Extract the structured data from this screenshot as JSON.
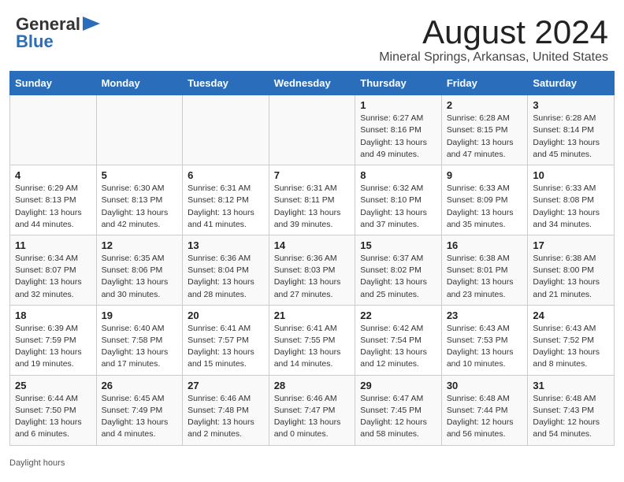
{
  "header": {
    "logo_general": "General",
    "logo_blue": "Blue",
    "month_title": "August 2024",
    "location": "Mineral Springs, Arkansas, United States"
  },
  "days_of_week": [
    "Sunday",
    "Monday",
    "Tuesday",
    "Wednesday",
    "Thursday",
    "Friday",
    "Saturday"
  ],
  "weeks": [
    [
      {
        "day": "",
        "info": ""
      },
      {
        "day": "",
        "info": ""
      },
      {
        "day": "",
        "info": ""
      },
      {
        "day": "",
        "info": ""
      },
      {
        "day": "1",
        "info": "Sunrise: 6:27 AM\nSunset: 8:16 PM\nDaylight: 13 hours\nand 49 minutes."
      },
      {
        "day": "2",
        "info": "Sunrise: 6:28 AM\nSunset: 8:15 PM\nDaylight: 13 hours\nand 47 minutes."
      },
      {
        "day": "3",
        "info": "Sunrise: 6:28 AM\nSunset: 8:14 PM\nDaylight: 13 hours\nand 45 minutes."
      }
    ],
    [
      {
        "day": "4",
        "info": "Sunrise: 6:29 AM\nSunset: 8:13 PM\nDaylight: 13 hours\nand 44 minutes."
      },
      {
        "day": "5",
        "info": "Sunrise: 6:30 AM\nSunset: 8:13 PM\nDaylight: 13 hours\nand 42 minutes."
      },
      {
        "day": "6",
        "info": "Sunrise: 6:31 AM\nSunset: 8:12 PM\nDaylight: 13 hours\nand 41 minutes."
      },
      {
        "day": "7",
        "info": "Sunrise: 6:31 AM\nSunset: 8:11 PM\nDaylight: 13 hours\nand 39 minutes."
      },
      {
        "day": "8",
        "info": "Sunrise: 6:32 AM\nSunset: 8:10 PM\nDaylight: 13 hours\nand 37 minutes."
      },
      {
        "day": "9",
        "info": "Sunrise: 6:33 AM\nSunset: 8:09 PM\nDaylight: 13 hours\nand 35 minutes."
      },
      {
        "day": "10",
        "info": "Sunrise: 6:33 AM\nSunset: 8:08 PM\nDaylight: 13 hours\nand 34 minutes."
      }
    ],
    [
      {
        "day": "11",
        "info": "Sunrise: 6:34 AM\nSunset: 8:07 PM\nDaylight: 13 hours\nand 32 minutes."
      },
      {
        "day": "12",
        "info": "Sunrise: 6:35 AM\nSunset: 8:06 PM\nDaylight: 13 hours\nand 30 minutes."
      },
      {
        "day": "13",
        "info": "Sunrise: 6:36 AM\nSunset: 8:04 PM\nDaylight: 13 hours\nand 28 minutes."
      },
      {
        "day": "14",
        "info": "Sunrise: 6:36 AM\nSunset: 8:03 PM\nDaylight: 13 hours\nand 27 minutes."
      },
      {
        "day": "15",
        "info": "Sunrise: 6:37 AM\nSunset: 8:02 PM\nDaylight: 13 hours\nand 25 minutes."
      },
      {
        "day": "16",
        "info": "Sunrise: 6:38 AM\nSunset: 8:01 PM\nDaylight: 13 hours\nand 23 minutes."
      },
      {
        "day": "17",
        "info": "Sunrise: 6:38 AM\nSunset: 8:00 PM\nDaylight: 13 hours\nand 21 minutes."
      }
    ],
    [
      {
        "day": "18",
        "info": "Sunrise: 6:39 AM\nSunset: 7:59 PM\nDaylight: 13 hours\nand 19 minutes."
      },
      {
        "day": "19",
        "info": "Sunrise: 6:40 AM\nSunset: 7:58 PM\nDaylight: 13 hours\nand 17 minutes."
      },
      {
        "day": "20",
        "info": "Sunrise: 6:41 AM\nSunset: 7:57 PM\nDaylight: 13 hours\nand 15 minutes."
      },
      {
        "day": "21",
        "info": "Sunrise: 6:41 AM\nSunset: 7:55 PM\nDaylight: 13 hours\nand 14 minutes."
      },
      {
        "day": "22",
        "info": "Sunrise: 6:42 AM\nSunset: 7:54 PM\nDaylight: 13 hours\nand 12 minutes."
      },
      {
        "day": "23",
        "info": "Sunrise: 6:43 AM\nSunset: 7:53 PM\nDaylight: 13 hours\nand 10 minutes."
      },
      {
        "day": "24",
        "info": "Sunrise: 6:43 AM\nSunset: 7:52 PM\nDaylight: 13 hours\nand 8 minutes."
      }
    ],
    [
      {
        "day": "25",
        "info": "Sunrise: 6:44 AM\nSunset: 7:50 PM\nDaylight: 13 hours\nand 6 minutes."
      },
      {
        "day": "26",
        "info": "Sunrise: 6:45 AM\nSunset: 7:49 PM\nDaylight: 13 hours\nand 4 minutes."
      },
      {
        "day": "27",
        "info": "Sunrise: 6:46 AM\nSunset: 7:48 PM\nDaylight: 13 hours\nand 2 minutes."
      },
      {
        "day": "28",
        "info": "Sunrise: 6:46 AM\nSunset: 7:47 PM\nDaylight: 13 hours\nand 0 minutes."
      },
      {
        "day": "29",
        "info": "Sunrise: 6:47 AM\nSunset: 7:45 PM\nDaylight: 12 hours\nand 58 minutes."
      },
      {
        "day": "30",
        "info": "Sunrise: 6:48 AM\nSunset: 7:44 PM\nDaylight: 12 hours\nand 56 minutes."
      },
      {
        "day": "31",
        "info": "Sunrise: 6:48 AM\nSunset: 7:43 PM\nDaylight: 12 hours\nand 54 minutes."
      }
    ]
  ],
  "footer": {
    "note": "Daylight hours"
  }
}
